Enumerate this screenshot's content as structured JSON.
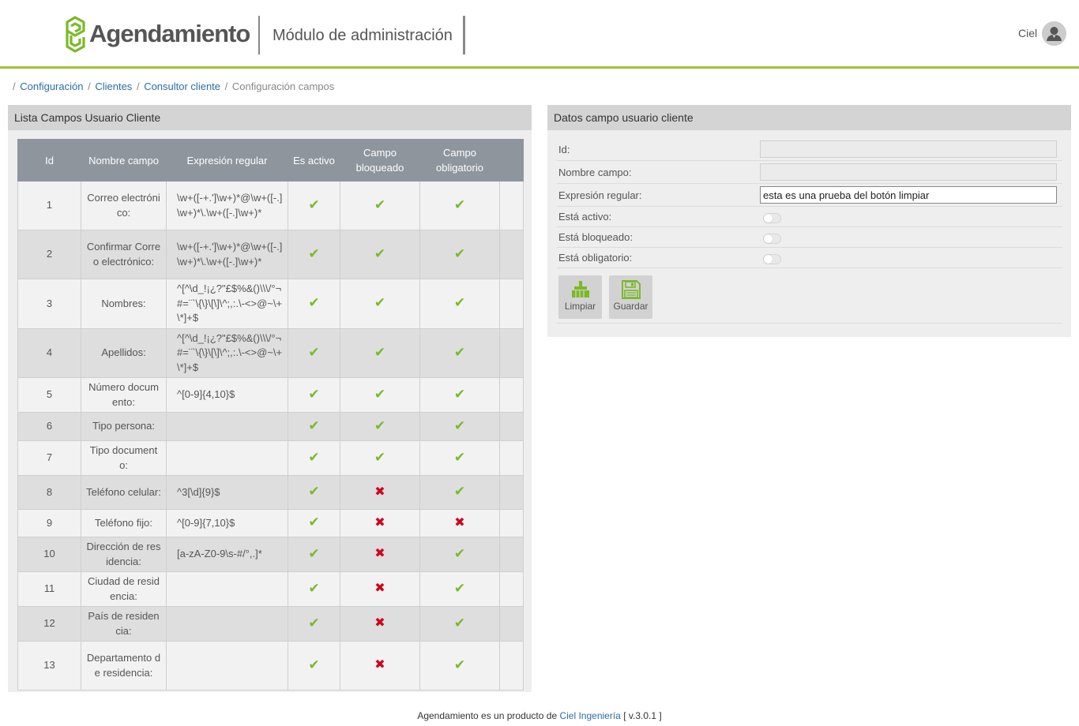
{
  "header": {
    "app_name": "Agendamiento",
    "module_title": "Módulo de administración",
    "user_name": "Ciel",
    "accent_color": "#9dc43a"
  },
  "breadcrumb": {
    "items": [
      "Configuración",
      "Clientes",
      "Consultor cliente"
    ],
    "current": "Configuración campos"
  },
  "list_panel": {
    "title": "Lista Campos Usuario Cliente",
    "columns": [
      "Id",
      "Nombre campo",
      "Expresión regular",
      "Es activo",
      "Campo bloqueado",
      "Campo obligatorio"
    ],
    "rows": [
      {
        "id": "1",
        "name": "Correo electrónico:",
        "regex": "\\w+([-+.']\\w+)*@\\w+([-.]\\w+)*\\.\\w+([-.]\\w+)*",
        "active": true,
        "locked": true,
        "required": true
      },
      {
        "id": "2",
        "name": "Confirmar Correo electrónico:",
        "regex": "\\w+([-+.']\\w+)*@\\w+([-.]\\w+)*\\.\\w+([-.]\\w+)*",
        "active": true,
        "locked": true,
        "required": true
      },
      {
        "id": "3",
        "name": "Nombres:",
        "regex": "^[^\\d_!¡¿?\"£$%&()\\\\\\/°¬#=¨`\\{\\}\\[\\]\\^;,:.\\-<>@~\\+\\*]+$",
        "active": true,
        "locked": true,
        "required": true
      },
      {
        "id": "4",
        "name": "Apellidos:",
        "regex": "^[^\\d_!¡¿?\"£$%&()\\\\\\/°¬#=¨`\\{\\}\\[\\]\\^;,:.\\-<>@~\\+\\*]+$",
        "active": true,
        "locked": true,
        "required": true
      },
      {
        "id": "5",
        "name": "Número documento:",
        "regex": "^[0-9]{4,10}$",
        "active": true,
        "locked": true,
        "required": true
      },
      {
        "id": "6",
        "name": "Tipo persona:",
        "regex": "",
        "active": true,
        "locked": true,
        "required": true
      },
      {
        "id": "7",
        "name": "Tipo documento:",
        "regex": "",
        "active": true,
        "locked": true,
        "required": true
      },
      {
        "id": "8",
        "name": "Teléfono celular:",
        "regex": "^3[\\d]{9}$",
        "active": true,
        "locked": false,
        "required": true
      },
      {
        "id": "9",
        "name": "Teléfono fijo:",
        "regex": "^[0-9]{7,10}$",
        "active": true,
        "locked": false,
        "required": false
      },
      {
        "id": "10",
        "name": "Dirección de residencia:",
        "regex": "[a-zA-Z0-9\\s-#/°,.]*",
        "active": true,
        "locked": false,
        "required": true
      },
      {
        "id": "11",
        "name": "Ciudad de residencia:",
        "regex": "",
        "active": true,
        "locked": false,
        "required": true
      },
      {
        "id": "12",
        "name": "País de residencia:",
        "regex": "",
        "active": true,
        "locked": false,
        "required": true
      },
      {
        "id": "13",
        "name": "Departamento de residencia:",
        "regex": "",
        "active": true,
        "locked": false,
        "required": true
      }
    ]
  },
  "form_panel": {
    "title": "Datos campo usuario cliente",
    "id_label": "Id:",
    "id_value": "",
    "name_label": "Nombre campo:",
    "name_value": "",
    "regex_label": "Expresión regular:",
    "regex_value": "esta es una prueba del botón limpiar",
    "active_label": "Está activo:",
    "locked_label": "Está bloqueado:",
    "required_label": "Está obligatorio:",
    "clear_button": "Limpiar",
    "save_button": "Guardar"
  },
  "footer": {
    "text": "Agendamiento es un producto de",
    "link": "Ciel Ingeniería",
    "version": "[ v.3.0.1 ]"
  }
}
